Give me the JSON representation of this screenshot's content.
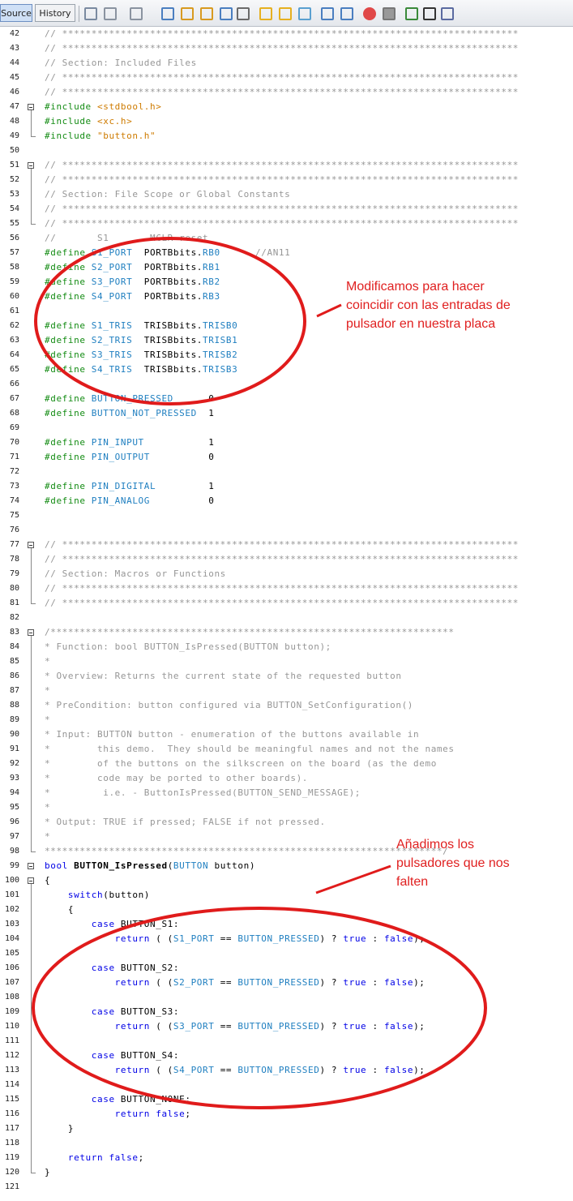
{
  "toolbar": {
    "tabs": [
      {
        "label": "Source",
        "active": true
      },
      {
        "label": "History",
        "active": false
      }
    ],
    "icons": [
      "last-edit-icon",
      "back-icon",
      "forward-icon",
      "find-icon",
      "find-previous-icon",
      "find-next-icon",
      "find-selection-icon",
      "toggle-highlight-icon",
      "previous-bookmark-icon",
      "next-bookmark-icon",
      "toggle-bookmark-icon",
      "shift-left-icon",
      "shift-right-icon",
      "start-macro-icon",
      "stop-macro-icon",
      "comment-icon",
      "uncomment-icon",
      "format-icon"
    ]
  },
  "editor": {
    "lines": [
      {
        "n": "42",
        "s": [
          [
            "cm",
            "// ******************************************************************************"
          ]
        ]
      },
      {
        "n": "43",
        "s": [
          [
            "cm",
            "// ******************************************************************************"
          ]
        ]
      },
      {
        "n": "44",
        "s": [
          [
            "cm",
            "// Section: Included Files"
          ]
        ]
      },
      {
        "n": "45",
        "s": [
          [
            "cm",
            "// ******************************************************************************"
          ]
        ]
      },
      {
        "n": "46",
        "s": [
          [
            "cm",
            "// ******************************************************************************"
          ]
        ]
      },
      {
        "n": "47",
        "s": [
          [
            "pp",
            "#include "
          ],
          [
            "st",
            "<stdbool.h>"
          ]
        ]
      },
      {
        "n": "48",
        "s": [
          [
            "pp",
            "#include "
          ],
          [
            "st",
            "<xc.h>"
          ]
        ]
      },
      {
        "n": "49",
        "s": [
          [
            "pp",
            "#include "
          ],
          [
            "st",
            "\"button.h\""
          ]
        ]
      },
      {
        "n": "50",
        "s": []
      },
      {
        "n": "51",
        "s": [
          [
            "cm",
            "// ******************************************************************************"
          ]
        ]
      },
      {
        "n": "52",
        "s": [
          [
            "cm",
            "// ******************************************************************************"
          ]
        ]
      },
      {
        "n": "53",
        "s": [
          [
            "cm",
            "// Section: File Scope or Global Constants"
          ]
        ]
      },
      {
        "n": "54",
        "s": [
          [
            "cm",
            "// ******************************************************************************"
          ]
        ]
      },
      {
        "n": "55",
        "s": [
          [
            "cm",
            "// ******************************************************************************"
          ]
        ]
      },
      {
        "n": "56",
        "s": [
          [
            "cm",
            "//       S1       MCLR reset"
          ]
        ]
      },
      {
        "n": "57",
        "s": [
          [
            "pp",
            "#define "
          ],
          [
            "mc",
            "S1_PORT"
          ],
          [
            "tx",
            "  PORTBbits."
          ],
          [
            "mc",
            "RB0"
          ],
          [
            "cm",
            "      //AN11"
          ]
        ]
      },
      {
        "n": "58",
        "s": [
          [
            "pp",
            "#define "
          ],
          [
            "mc",
            "S2_PORT"
          ],
          [
            "tx",
            "  PORTBbits."
          ],
          [
            "mc",
            "RB1"
          ]
        ]
      },
      {
        "n": "59",
        "s": [
          [
            "pp",
            "#define "
          ],
          [
            "mc",
            "S3_PORT"
          ],
          [
            "tx",
            "  PORTBbits."
          ],
          [
            "mc",
            "RB2"
          ]
        ]
      },
      {
        "n": "60",
        "s": [
          [
            "pp",
            "#define "
          ],
          [
            "mc",
            "S4_PORT"
          ],
          [
            "tx",
            "  PORTBbits."
          ],
          [
            "mc",
            "RB3"
          ]
        ]
      },
      {
        "n": "61",
        "s": []
      },
      {
        "n": "62",
        "s": [
          [
            "pp",
            "#define "
          ],
          [
            "mc",
            "S1_TRIS"
          ],
          [
            "tx",
            "  TRISBbits."
          ],
          [
            "mc",
            "TRISB0"
          ]
        ]
      },
      {
        "n": "63",
        "s": [
          [
            "pp",
            "#define "
          ],
          [
            "mc",
            "S2_TRIS"
          ],
          [
            "tx",
            "  TRISBbits."
          ],
          [
            "mc",
            "TRISB1"
          ]
        ]
      },
      {
        "n": "64",
        "s": [
          [
            "pp",
            "#define "
          ],
          [
            "mc",
            "S3_TRIS"
          ],
          [
            "tx",
            "  TRISBbits."
          ],
          [
            "mc",
            "TRISB2"
          ]
        ]
      },
      {
        "n": "65",
        "s": [
          [
            "pp",
            "#define "
          ],
          [
            "mc",
            "S4_TRIS"
          ],
          [
            "tx",
            "  TRISBbits."
          ],
          [
            "mc",
            "TRISB3"
          ]
        ]
      },
      {
        "n": "66",
        "s": []
      },
      {
        "n": "67",
        "s": [
          [
            "pp",
            "#define "
          ],
          [
            "mc",
            "BUTTON_PRESSED"
          ],
          [
            "tx",
            "      0"
          ]
        ]
      },
      {
        "n": "68",
        "s": [
          [
            "pp",
            "#define "
          ],
          [
            "mc",
            "BUTTON_NOT_PRESSED"
          ],
          [
            "tx",
            "  1"
          ]
        ]
      },
      {
        "n": "69",
        "s": []
      },
      {
        "n": "70",
        "s": [
          [
            "pp",
            "#define "
          ],
          [
            "mc",
            "PIN_INPUT"
          ],
          [
            "tx",
            "           1"
          ]
        ]
      },
      {
        "n": "71",
        "s": [
          [
            "pp",
            "#define "
          ],
          [
            "mc",
            "PIN_OUTPUT"
          ],
          [
            "tx",
            "          0"
          ]
        ]
      },
      {
        "n": "72",
        "s": []
      },
      {
        "n": "73",
        "s": [
          [
            "pp",
            "#define "
          ],
          [
            "mc",
            "PIN_DIGITAL"
          ],
          [
            "tx",
            "         1"
          ]
        ]
      },
      {
        "n": "74",
        "s": [
          [
            "pp",
            "#define "
          ],
          [
            "mc",
            "PIN_ANALOG"
          ],
          [
            "tx",
            "          0"
          ]
        ]
      },
      {
        "n": "75",
        "s": []
      },
      {
        "n": "76",
        "s": []
      },
      {
        "n": "77",
        "s": [
          [
            "cm",
            "// ******************************************************************************"
          ]
        ]
      },
      {
        "n": "78",
        "s": [
          [
            "cm",
            "// ******************************************************************************"
          ]
        ]
      },
      {
        "n": "79",
        "s": [
          [
            "cm",
            "// Section: Macros or Functions"
          ]
        ]
      },
      {
        "n": "80",
        "s": [
          [
            "cm",
            "// ******************************************************************************"
          ]
        ]
      },
      {
        "n": "81",
        "s": [
          [
            "cm",
            "// ******************************************************************************"
          ]
        ]
      },
      {
        "n": "82",
        "s": []
      },
      {
        "n": "83",
        "s": [
          [
            "cm",
            "/*********************************************************************"
          ]
        ]
      },
      {
        "n": "84",
        "s": [
          [
            "cm",
            "* Function: bool BUTTON_IsPressed(BUTTON button);"
          ]
        ]
      },
      {
        "n": "85",
        "s": [
          [
            "cm",
            "*"
          ]
        ]
      },
      {
        "n": "86",
        "s": [
          [
            "cm",
            "* Overview: Returns the current state of the requested button"
          ]
        ]
      },
      {
        "n": "87",
        "s": [
          [
            "cm",
            "*"
          ]
        ]
      },
      {
        "n": "88",
        "s": [
          [
            "cm",
            "* PreCondition: button configured via BUTTON_SetConfiguration()"
          ]
        ]
      },
      {
        "n": "89",
        "s": [
          [
            "cm",
            "*"
          ]
        ]
      },
      {
        "n": "90",
        "s": [
          [
            "cm",
            "* Input: BUTTON button - enumeration of the buttons available in"
          ]
        ]
      },
      {
        "n": "91",
        "s": [
          [
            "cm",
            "*        this demo.  They should be meaningful names and not the names"
          ]
        ]
      },
      {
        "n": "92",
        "s": [
          [
            "cm",
            "*        of the buttons on the silkscreen on the board (as the demo"
          ]
        ]
      },
      {
        "n": "93",
        "s": [
          [
            "cm",
            "*        code may be ported to other boards)."
          ]
        ]
      },
      {
        "n": "94",
        "s": [
          [
            "cm",
            "*         i.e. - ButtonIsPressed(BUTTON_SEND_MESSAGE);"
          ]
        ]
      },
      {
        "n": "95",
        "s": [
          [
            "cm",
            "*"
          ]
        ]
      },
      {
        "n": "96",
        "s": [
          [
            "cm",
            "* Output: TRUE if pressed; FALSE if not pressed."
          ]
        ]
      },
      {
        "n": "97",
        "s": [
          [
            "cm",
            "*"
          ]
        ]
      },
      {
        "n": "98",
        "s": [
          [
            "cm",
            "********************************************************************/"
          ]
        ]
      },
      {
        "n": "99",
        "s": [
          [
            "kw",
            "bool "
          ],
          [
            "fn",
            "BUTTON_IsPressed"
          ],
          [
            "tx",
            "("
          ],
          [
            "mc",
            "BUTTON"
          ],
          [
            "tx",
            " button)"
          ]
        ]
      },
      {
        "n": "100",
        "s": [
          [
            "tx",
            "{"
          ]
        ]
      },
      {
        "n": "101",
        "s": [
          [
            "kw",
            "    switch"
          ],
          [
            "tx",
            "(button)"
          ]
        ]
      },
      {
        "n": "102",
        "s": [
          [
            "tx",
            "    {"
          ]
        ]
      },
      {
        "n": "103",
        "s": [
          [
            "kw",
            "        case"
          ],
          [
            "tx",
            " BUTTON_S1:"
          ]
        ]
      },
      {
        "n": "104",
        "s": [
          [
            "kw",
            "            return"
          ],
          [
            "tx",
            " ( ("
          ],
          [
            "mc",
            "S1_PORT"
          ],
          [
            "tx",
            " == "
          ],
          [
            "mc",
            "BUTTON_PRESSED"
          ],
          [
            "tx",
            ") ? "
          ],
          [
            "kw",
            "true"
          ],
          [
            "tx",
            " : "
          ],
          [
            "kw",
            "false"
          ],
          [
            "tx",
            ");"
          ]
        ]
      },
      {
        "n": "105",
        "s": []
      },
      {
        "n": "106",
        "s": [
          [
            "kw",
            "        case"
          ],
          [
            "tx",
            " BUTTON_S2:"
          ]
        ]
      },
      {
        "n": "107",
        "s": [
          [
            "kw",
            "            return"
          ],
          [
            "tx",
            " ( ("
          ],
          [
            "mc",
            "S2_PORT"
          ],
          [
            "tx",
            " == "
          ],
          [
            "mc",
            "BUTTON_PRESSED"
          ],
          [
            "tx",
            ") ? "
          ],
          [
            "kw",
            "true"
          ],
          [
            "tx",
            " : "
          ],
          [
            "kw",
            "false"
          ],
          [
            "tx",
            ");"
          ]
        ]
      },
      {
        "n": "108",
        "s": []
      },
      {
        "n": "109",
        "s": [
          [
            "kw",
            "        case"
          ],
          [
            "tx",
            " BUTTON_S3:"
          ]
        ]
      },
      {
        "n": "110",
        "s": [
          [
            "kw",
            "            return"
          ],
          [
            "tx",
            " ( ("
          ],
          [
            "mc",
            "S3_PORT"
          ],
          [
            "tx",
            " == "
          ],
          [
            "mc",
            "BUTTON_PRESSED"
          ],
          [
            "tx",
            ") ? "
          ],
          [
            "kw",
            "true"
          ],
          [
            "tx",
            " : "
          ],
          [
            "kw",
            "false"
          ],
          [
            "tx",
            ");"
          ]
        ]
      },
      {
        "n": "111",
        "s": []
      },
      {
        "n": "112",
        "s": [
          [
            "kw",
            "        case"
          ],
          [
            "tx",
            " BUTTON_S4:"
          ]
        ]
      },
      {
        "n": "113",
        "s": [
          [
            "kw",
            "            return"
          ],
          [
            "tx",
            " ( ("
          ],
          [
            "mc",
            "S4_PORT"
          ],
          [
            "tx",
            " == "
          ],
          [
            "mc",
            "BUTTON_PRESSED"
          ],
          [
            "tx",
            ") ? "
          ],
          [
            "kw",
            "true"
          ],
          [
            "tx",
            " : "
          ],
          [
            "kw",
            "false"
          ],
          [
            "tx",
            ");"
          ]
        ]
      },
      {
        "n": "114",
        "s": []
      },
      {
        "n": "115",
        "s": [
          [
            "kw",
            "        case"
          ],
          [
            "tx",
            " BUTTON_NONE:"
          ]
        ]
      },
      {
        "n": "116",
        "s": [
          [
            "kw",
            "            return false"
          ],
          [
            "tx",
            ";"
          ]
        ]
      },
      {
        "n": "117",
        "s": [
          [
            "tx",
            "    }"
          ]
        ]
      },
      {
        "n": "118",
        "s": []
      },
      {
        "n": "119",
        "s": [
          [
            "kw",
            "    return false"
          ],
          [
            "tx",
            ";"
          ]
        ]
      },
      {
        "n": "120",
        "s": [
          [
            "tx",
            "}"
          ]
        ]
      },
      {
        "n": "121",
        "s": []
      }
    ],
    "folds": [
      "47",
      "51",
      "77",
      "83",
      "99",
      "100"
    ]
  },
  "annotations": {
    "first": [
      "Modificamos para hacer",
      "coincidir con las entradas de",
      "pulsador en nuestra placa"
    ],
    "second": [
      "Añadimos los",
      "pulsadores que nos",
      "falten"
    ],
    "color": "#e02020"
  },
  "colors": {
    "comment": "#969696",
    "preprocessor": "#148c14",
    "macro": "#1f7fc0",
    "string": "#ce7b00",
    "keyword": "#0000e6"
  }
}
